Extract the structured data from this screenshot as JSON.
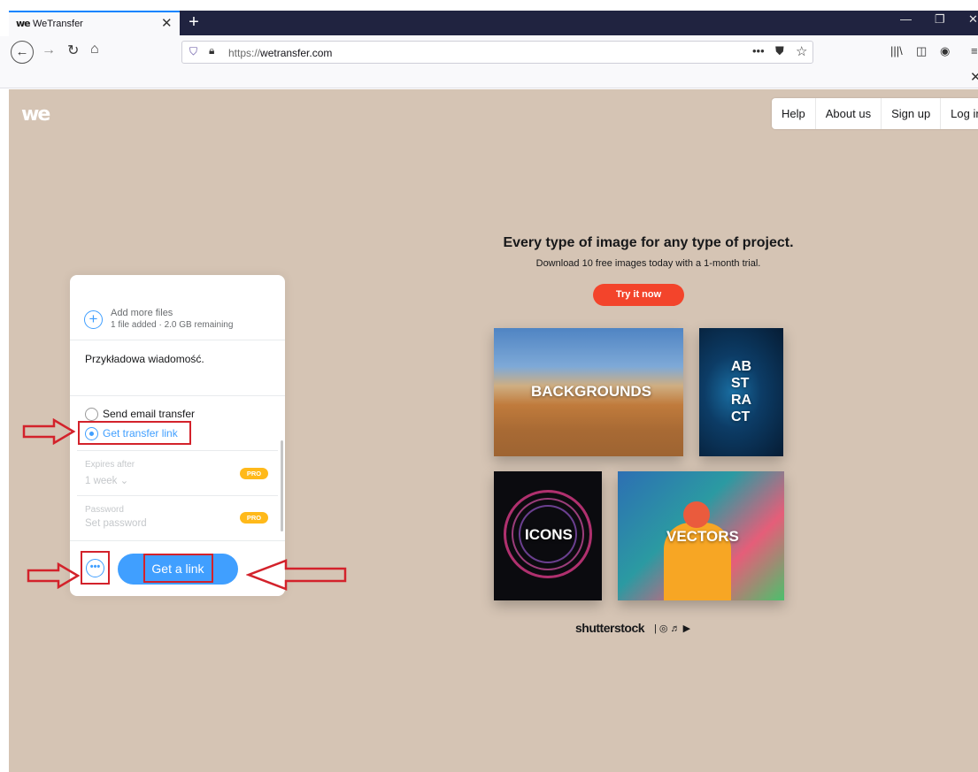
{
  "browser": {
    "tab_title": "WeTransfer",
    "tab_favicon": "we",
    "tab_close": "✕",
    "new_tab": "+",
    "url_scheme": "https://",
    "url_host": "wetransfer.com",
    "url_more": "•••",
    "window_controls": {
      "minimize": "—",
      "restore": "❐",
      "close": "✕"
    },
    "notification_close": "✕"
  },
  "site": {
    "logo": "we",
    "nav": [
      "Help",
      "About us",
      "Sign up",
      "Log in"
    ]
  },
  "panel": {
    "add_title": "Add more files",
    "add_subtitle": "1 file added · 2.0 GB remaining",
    "add_icon": "+",
    "message": "Przykładowa wiadomość.",
    "option_email": "Send email transfer",
    "option_link": "Get transfer link",
    "selected_option": "Get transfer link",
    "expires_label": "Expires after",
    "expires_value": "1 week ⌄",
    "password_label": "Password",
    "password_placeholder": "Set password",
    "pro_badge": "PRO",
    "more_icon": "•••",
    "submit_label": "Get a link"
  },
  "ad": {
    "headline": "Every type of image for any type of project.",
    "subline": "Download 10 free images today with a 1-month trial.",
    "cta": "Try it now",
    "tiles": [
      "BACKGROUNDS",
      "AB\nST\nRA\nCT",
      "ICONS",
      "VECTORS"
    ],
    "brand": "shutterstock",
    "brand_icons": "| ◎ ♬ ▶"
  },
  "colors": {
    "page_bg": "#d5c4b4",
    "accent_blue": "#409fff",
    "cta_red": "#f3442b",
    "pro_yellow": "#ffb91a",
    "annotation_red": "#d3222b",
    "titlebar": "#202340"
  },
  "icons": {
    "back": "arrow-left-icon",
    "forward": "arrow-right-icon",
    "reload": "reload-icon",
    "home": "home-icon",
    "shield": "tracking-shield-icon",
    "lock": "lock-icon",
    "pocket": "pocket-icon",
    "bookmark": "star-icon",
    "library": "library-icon",
    "sidebar": "sidebar-icon",
    "account": "account-icon",
    "menu": "hamburger-menu-icon"
  }
}
